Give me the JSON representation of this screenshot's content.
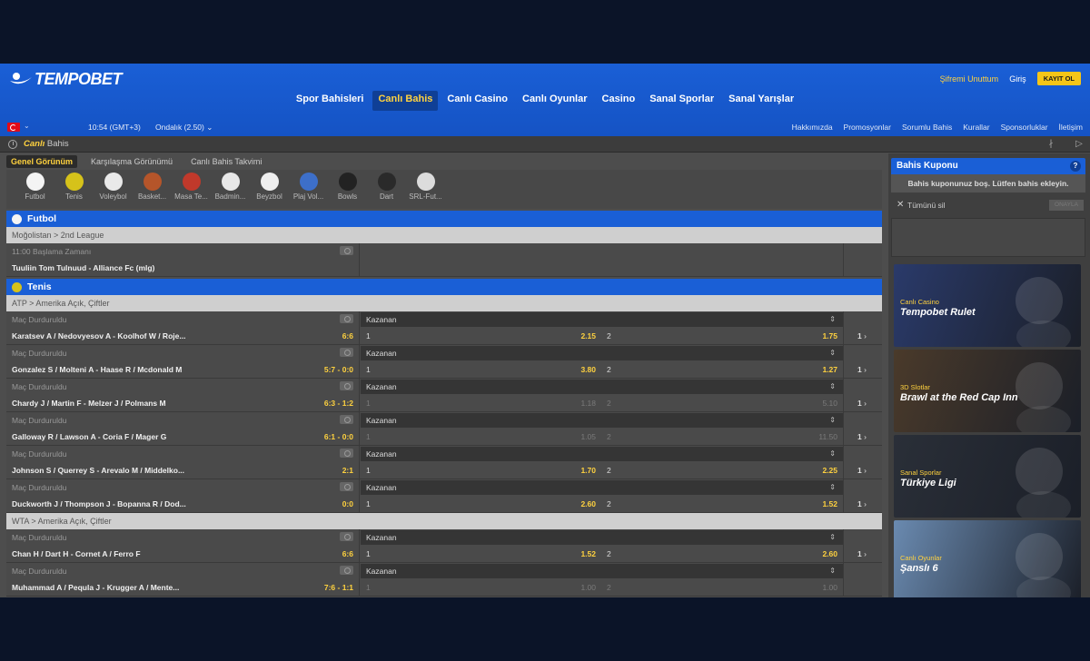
{
  "brand": {
    "name": "TEMPOBET"
  },
  "top_links": {
    "forgot": "Şifremi Unuttum",
    "login": "Giriş",
    "register": "KAYIT OL"
  },
  "main_nav": [
    "Spor Bahisleri",
    "Canlı Bahis",
    "Canlı Casino",
    "Canlı Oyunlar",
    "Casino",
    "Sanal Sporlar",
    "Sanal Yarışlar"
  ],
  "sub_bar": {
    "time": "10:54 (GMT+3)",
    "odds_format": "Ondalık (2.50)",
    "links": [
      "Hakkımızda",
      "Promosyonlar",
      "Sorumlu Bahis",
      "Kurallar",
      "Sponsorluklar",
      "İletişim"
    ]
  },
  "page_title": {
    "highlight": "Canlı",
    "rest": " Bahis"
  },
  "view_tabs": [
    "Genel Görünüm",
    "Karşılaşma Görünümü",
    "Canlı Bahis Takvimi"
  ],
  "sports": [
    {
      "label": "Futbol",
      "color": "#f4f4f4"
    },
    {
      "label": "Tenis",
      "color": "#d6c21a"
    },
    {
      "label": "Voleybol",
      "color": "#e9e9e9"
    },
    {
      "label": "Basket...",
      "color": "#b5552a"
    },
    {
      "label": "Masa Te...",
      "color": "#c0392b"
    },
    {
      "label": "Badmin...",
      "color": "#e8e8e8"
    },
    {
      "label": "Beyzbol",
      "color": "#efefef"
    },
    {
      "label": "Plaj Vol...",
      "color": "#3d6fc9"
    },
    {
      "label": "Bowls",
      "color": "#222222"
    },
    {
      "label": "Dart",
      "color": "#2a2a2a"
    },
    {
      "label": "SRL-Fut...",
      "color": "#dcdcdc"
    }
  ],
  "sections": {
    "futbol": {
      "title": "Futbol",
      "league": "Moğolistan > 2nd League",
      "match": {
        "status": "11:00 Başlama Zamanı",
        "name": "Tuuliin Tom Tulnuud - Alliance Fc (mlg)"
      }
    },
    "tenis": {
      "title": "Tenis",
      "leagues": [
        "ATP > Amerika Açık, Çiftler",
        "WTA > Amerika Açık, Çiftler"
      ],
      "market": "Kazanan",
      "matches": [
        {
          "status": "Maç Durduruldu",
          "name": "Karatsev A / Nedovyesov A - Koolhof W / Roje...",
          "score": "6:6",
          "o1": "1",
          "v1": "2.15",
          "o2": "2",
          "v2": "1.75",
          "more": "1",
          "disabled": false
        },
        {
          "status": "Maç Durduruldu",
          "name": "Gonzalez S / Molteni A - Haase R / Mcdonald M",
          "score": "5:7 - 0:0",
          "o1": "1",
          "v1": "3.80",
          "o2": "2",
          "v2": "1.27",
          "more": "1",
          "disabled": false
        },
        {
          "status": "Maç Durduruldu",
          "name": "Chardy J / Martin F - Melzer J / Polmans M",
          "score": "6:3 - 1:2",
          "o1": "1",
          "v1": "1.18",
          "o2": "2",
          "v2": "5.10",
          "more": "1",
          "disabled": true
        },
        {
          "status": "Maç Durduruldu",
          "name": "Galloway R / Lawson A - Coria F / Mager G",
          "score": "6:1 - 0:0",
          "o1": "1",
          "v1": "1.05",
          "o2": "2",
          "v2": "11.50",
          "more": "1",
          "disabled": true
        },
        {
          "status": "Maç Durduruldu",
          "name": "Johnson S / Querrey S - Arevalo M / Middelko...",
          "score": "2:1",
          "o1": "1",
          "v1": "1.70",
          "o2": "2",
          "v2": "2.25",
          "more": "1",
          "disabled": false
        },
        {
          "status": "Maç Durduruldu",
          "name": "Duckworth J / Thompson J - Bopanna R / Dod...",
          "score": "0:0",
          "o1": "1",
          "v1": "2.60",
          "o2": "2",
          "v2": "1.52",
          "more": "1",
          "disabled": false
        }
      ],
      "wta_matches": [
        {
          "status": "Maç Durduruldu",
          "name": "Chan H / Dart H - Cornet A / Ferro F",
          "score": "6:6",
          "o1": "1",
          "v1": "1.52",
          "o2": "2",
          "v2": "2.60",
          "more": "1",
          "disabled": false
        },
        {
          "status": "Maç Durduruldu",
          "name": "Muhammad A / Pequla J - Krugger A / Mente...",
          "score": "7:6 - 1:1",
          "o1": "1",
          "v1": "1.00",
          "o2": "2",
          "v2": "1.00",
          "more": "",
          "disabled": true
        }
      ]
    }
  },
  "coupon": {
    "title": "Bahis Kuponu",
    "help": "?",
    "empty": "Bahis kuponunuz boş. Lütfen bahis ekleyin.",
    "clear": "Tümünü sil",
    "confirm": "ONAYLA"
  },
  "promos": [
    {
      "tag": "Canlı Casino",
      "title": "Tempobet Rulet",
      "bg": "#2a3a6a"
    },
    {
      "tag": "3D Slotlar",
      "title": "Brawl at the Red Cap Inn",
      "bg": "#4a3a2a"
    },
    {
      "tag": "Sanal Sporlar",
      "title": "Türkiye Ligi",
      "bg": "#2a2f38"
    },
    {
      "tag": "Canlı Oyunlar",
      "title": "Şanslı 6",
      "bg": "#6a8ab0"
    }
  ]
}
